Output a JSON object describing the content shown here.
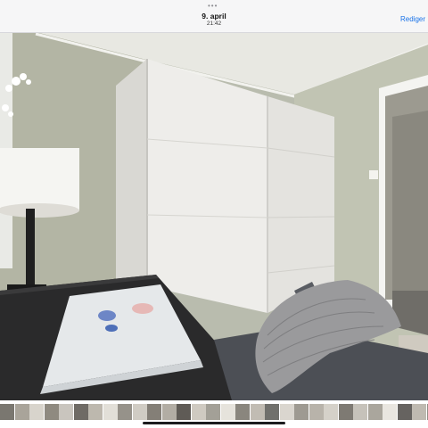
{
  "header": {
    "grabber": "•••",
    "date": "9. april",
    "time": "21:42",
    "edit_label": "Rediger"
  },
  "photo": {
    "subject": "Bedroom with white sliding wardrobe, desk with lamp and open magazine, grey sofa with knit throw",
    "wall_color": "#b7baa9",
    "wardrobe_color": "#eeedea"
  },
  "thumbnail_strip": {
    "colors": [
      "#7a7770",
      "#a9a49a",
      "#d8d4cc",
      "#8f8a80",
      "#c9c5be",
      "#6f6b65",
      "#bdb8ae",
      "#e2dfd8",
      "#96928a",
      "#d0ccc4",
      "#847f77",
      "#b2ada4",
      "#5f5b56",
      "#cfcac1",
      "#a3a097",
      "#e6e3dc",
      "#8a867e",
      "#c1bcb3",
      "#70706c",
      "#dad6cf",
      "#9e9a92",
      "#b8b3aa",
      "#d5d1c9",
      "#7e7a73",
      "#c6c2ba",
      "#aaa69d",
      "#e9e6e0",
      "#666360",
      "#bfbab1",
      "#928e86"
    ],
    "home_indicator": "home-bar"
  }
}
